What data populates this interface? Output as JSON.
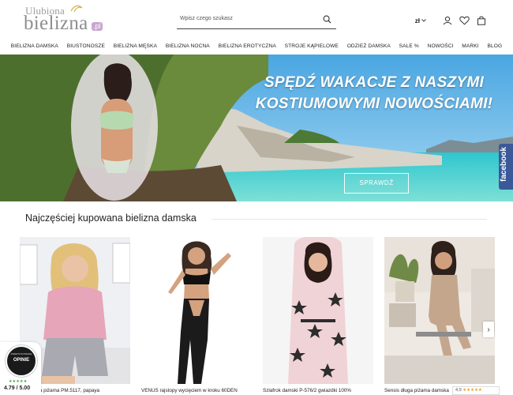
{
  "logo": {
    "line1": "Ulubiona",
    "line2": "bielizna",
    "tld": ".pl"
  },
  "search": {
    "placeholder": "Wpisz czego szukasz"
  },
  "header": {
    "currency": "zł"
  },
  "nav": [
    "BIELIZNA DAMSKA",
    "BIUSTONOSZE",
    "BIELIZNA MĘSKA",
    "BIELIZNA NOCNA",
    "BIELIZNA EROTYCZNA",
    "STROJE KĄPIELOWE",
    "ODZIEŻ DAMSKA",
    "SALE %",
    "NOWOŚCI",
    "MARKI",
    "BLOG"
  ],
  "banner": {
    "headline_line1": "SPĘDŹ WAKACJE Z NASZYMI",
    "headline_line2": "KOSTIUMOWYMI NOWOŚCIAMI!",
    "cta": "SPRAWDŹ"
  },
  "facebook_tab": "facebook",
  "section": {
    "title": "Najczęściej kupowana bielizna damska"
  },
  "products": [
    {
      "name": "awełniana piżama PM.5117, papaya"
    },
    {
      "name": "VENUS rajstopy wycięciem w kroku 60DEN"
    },
    {
      "name": "Szlafrok damski P-576/2 gwiazdki 100%"
    },
    {
      "name": "Sensis długa piżama damska"
    }
  ],
  "badge": {
    "brand_line": "ZWERYFIKOWANE",
    "brand": "OPINIE",
    "stars": "★★★★★",
    "score": "4.79 / 5.00"
  },
  "mini_badge": {
    "score": "4,9",
    "stars": "★★★★★"
  },
  "colors": {
    "facebook": "#3b5998",
    "sky": "#63b4e6",
    "sea": "#2fc6cf",
    "badge_green": "#3ea33e",
    "logo_accent": "#c8a7cf"
  }
}
